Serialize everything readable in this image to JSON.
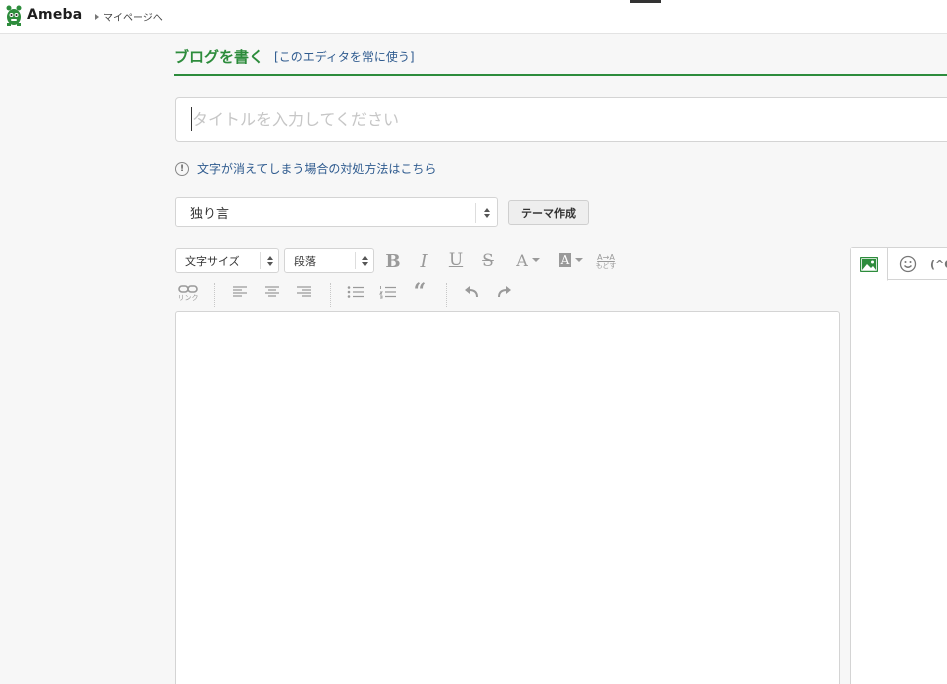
{
  "header": {
    "logo_text": "Ameba",
    "mypage_link": "マイページへ"
  },
  "page": {
    "title": "ブログを書く",
    "editor_link": "[このエディタを常に使う]"
  },
  "title_input": {
    "placeholder": "タイトルを入力してください",
    "value": ""
  },
  "notice": {
    "text": "文字が消えてしまう場合の対処方法はこちら"
  },
  "theme": {
    "selected": "独り言",
    "create_button": "テーマ作成"
  },
  "toolbar": {
    "font_size_select": "文字サイズ",
    "paragraph_select": "段落",
    "bold": "B",
    "italic": "I",
    "underline": "U",
    "strike": "S",
    "font_color": "A",
    "bg_color": "A",
    "reset_label_top": "A→A",
    "reset_label_bottom": "もどす",
    "link_label": "リンク",
    "quote": "“"
  },
  "side_panel": {
    "tabs": [
      "image-icon",
      "emoji-icon",
      "(^o"
    ],
    "kaomoji_tab": "(^O"
  },
  "colors": {
    "accent": "#2d8c3c",
    "link": "#2f5b8f"
  }
}
